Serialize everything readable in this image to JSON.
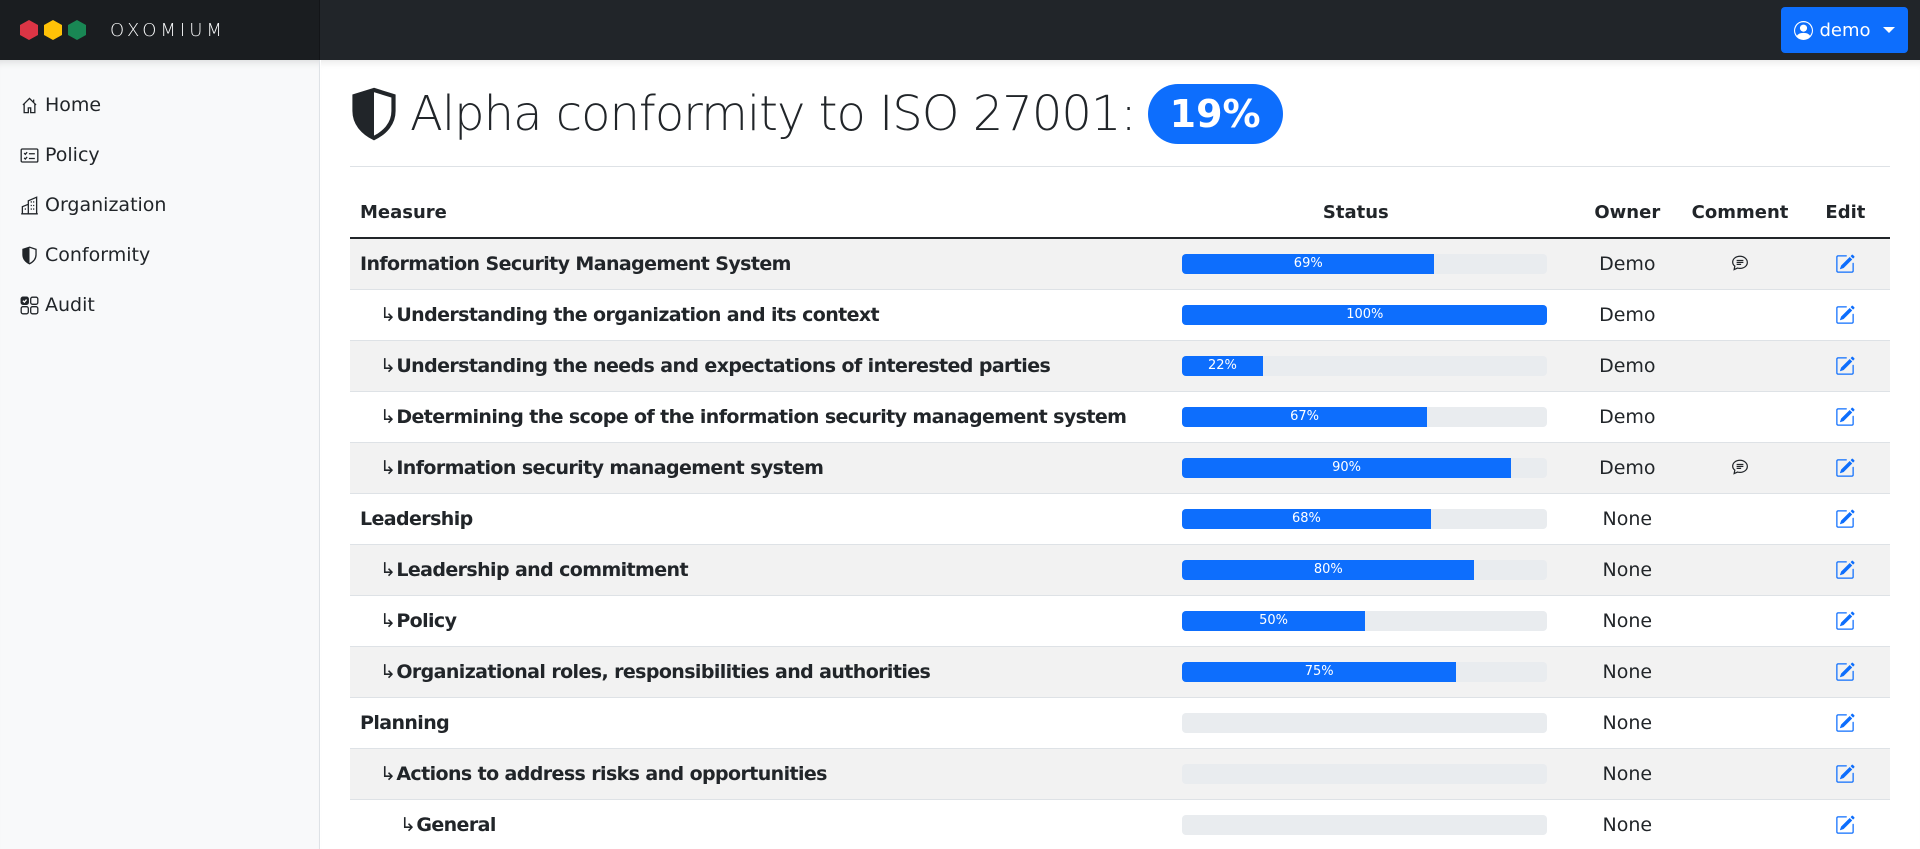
{
  "navbar": {
    "brand": "Oxomium",
    "logo_colors": [
      "#dc3545",
      "#ffc107",
      "#198754"
    ],
    "user_label": "demo"
  },
  "sidebar": {
    "items": [
      {
        "label": "Home",
        "icon": "house-icon"
      },
      {
        "label": "Policy",
        "icon": "card-checklist-icon"
      },
      {
        "label": "Organization",
        "icon": "buildings-icon"
      },
      {
        "label": "Conformity",
        "icon": "shield-half-icon"
      },
      {
        "label": "Audit",
        "icon": "ui-checks-grid-icon"
      }
    ]
  },
  "main": {
    "title": "Alpha conformity to ISO 27001:",
    "score_badge": "19%",
    "table": {
      "headers": {
        "measure": "Measure",
        "status": "Status",
        "owner": "Owner",
        "comment": "Comment",
        "edit": "Edit"
      },
      "rows": [
        {
          "level": 0,
          "measure": "Information Security Management System",
          "progress": 69,
          "progress_label": "69%",
          "owner": "Demo",
          "has_comment": true
        },
        {
          "level": 1,
          "measure": "Understanding the organization and its context",
          "progress": 100,
          "progress_label": "100%",
          "owner": "Demo",
          "has_comment": false
        },
        {
          "level": 1,
          "measure": "Understanding the needs and expectations of interested parties",
          "progress": 22,
          "progress_label": "22%",
          "owner": "Demo",
          "has_comment": false
        },
        {
          "level": 1,
          "measure": "Determining the scope of the information security management system",
          "progress": 67,
          "progress_label": "67%",
          "owner": "Demo",
          "has_comment": false
        },
        {
          "level": 1,
          "measure": "Information security management system",
          "progress": 90,
          "progress_label": "90%",
          "owner": "Demo",
          "has_comment": true
        },
        {
          "level": 0,
          "measure": "Leadership",
          "progress": 68,
          "progress_label": "68%",
          "owner": "None",
          "has_comment": false
        },
        {
          "level": 1,
          "measure": "Leadership and commitment",
          "progress": 80,
          "progress_label": "80%",
          "owner": "None",
          "has_comment": false
        },
        {
          "level": 1,
          "measure": "Policy",
          "progress": 50,
          "progress_label": "50%",
          "owner": "None",
          "has_comment": false
        },
        {
          "level": 1,
          "measure": "Organizational roles, responsibilities and authorities",
          "progress": 75,
          "progress_label": "75%",
          "owner": "None",
          "has_comment": false
        },
        {
          "level": 0,
          "measure": "Planning",
          "progress": 0,
          "progress_label": "",
          "owner": "None",
          "has_comment": false
        },
        {
          "level": 1,
          "measure": "Actions to address risks and opportunities",
          "progress": 0,
          "progress_label": "",
          "owner": "None",
          "has_comment": false
        },
        {
          "level": 2,
          "measure": "General",
          "progress": 0,
          "progress_label": "",
          "owner": "None",
          "has_comment": false
        }
      ]
    },
    "colors": {
      "primary": "#0d6efd",
      "navbar_bg": "#212529",
      "progress_track": "#e9ecef",
      "stripe": "#f2f2f2"
    }
  }
}
